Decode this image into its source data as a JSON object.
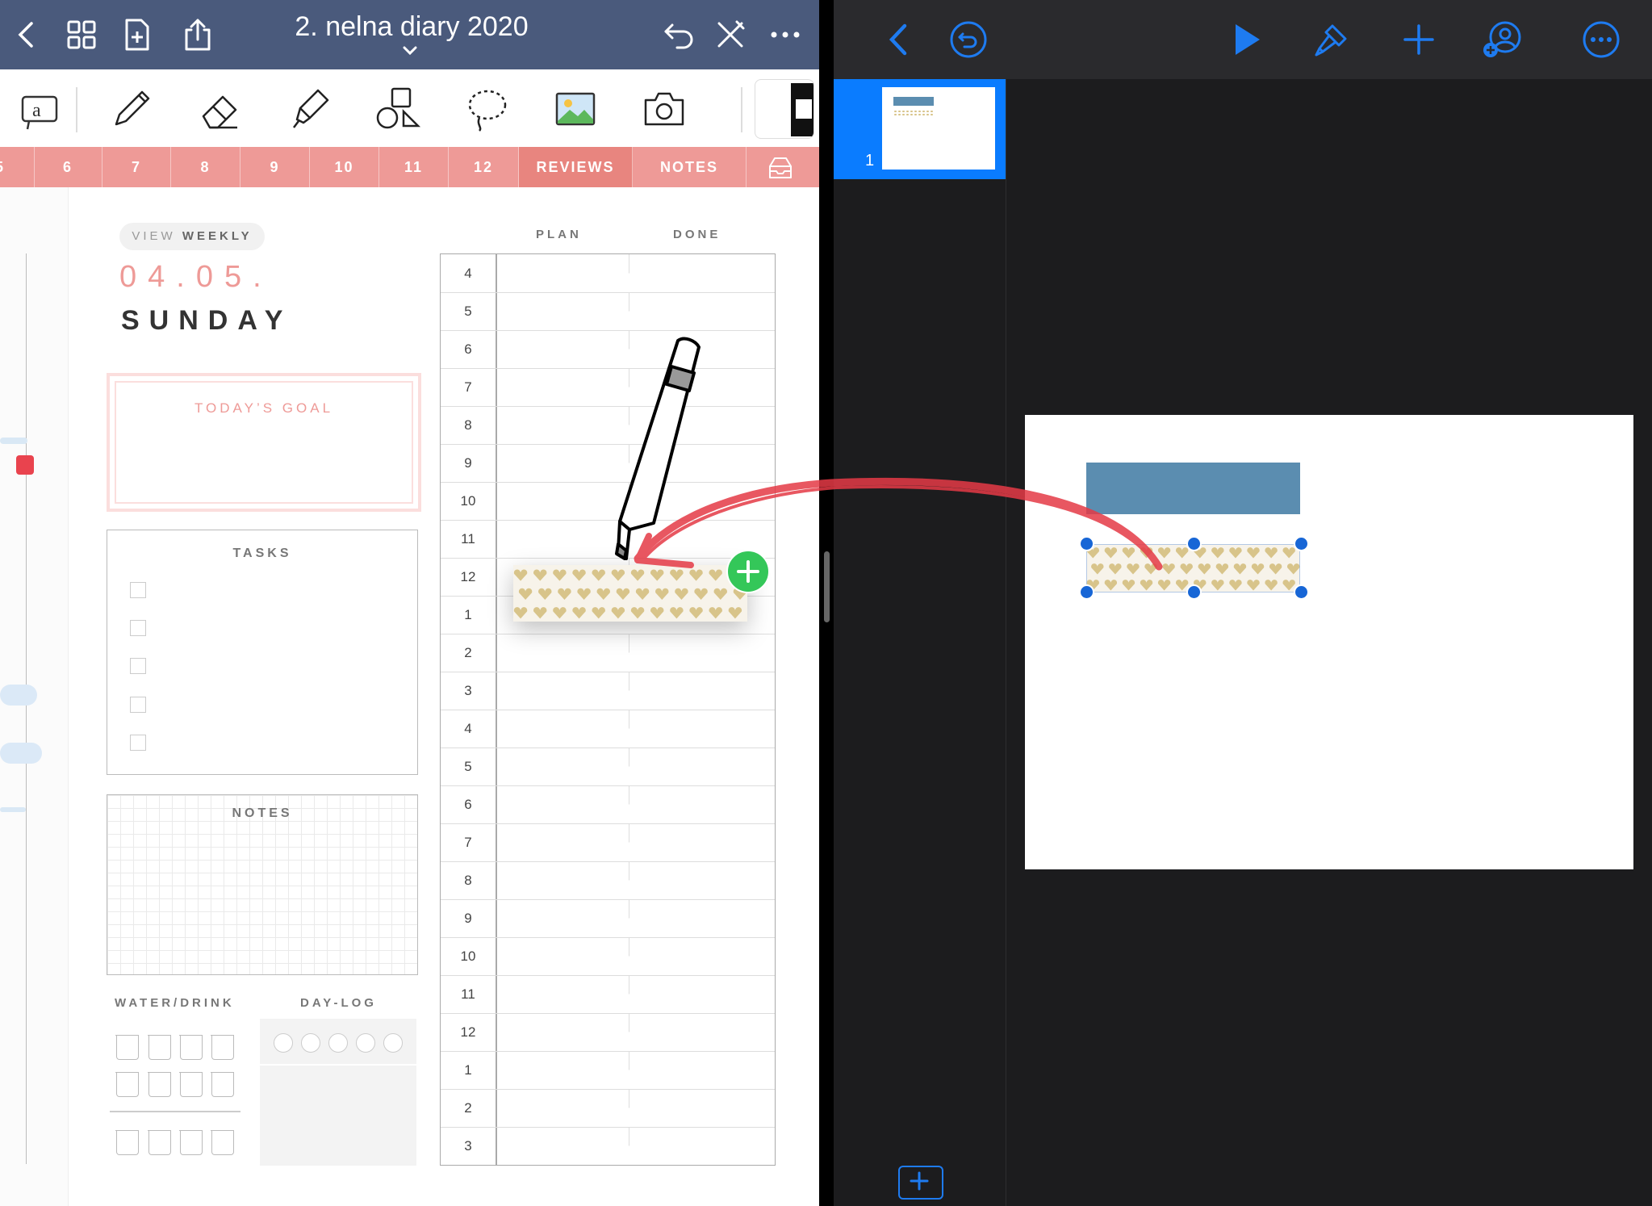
{
  "left_app": {
    "document_title": "2. nelna diary 2020",
    "tabs": [
      {
        "label": "5"
      },
      {
        "label": "6"
      },
      {
        "label": "7"
      },
      {
        "label": "8"
      },
      {
        "label": "9"
      },
      {
        "label": "10"
      },
      {
        "label": "11"
      },
      {
        "label": "12"
      },
      {
        "label": "REVIEWS"
      },
      {
        "label": "NOTES"
      }
    ],
    "planner": {
      "view_prefix": "VIEW",
      "view_mode": "WEEKLY",
      "date": "04.05.",
      "weekday": "SUNDAY",
      "todays_goal_label": "TODAY’S GOAL",
      "tasks_label": "TASKS",
      "notes_label": "NOTES",
      "plan_label": "PLAN",
      "done_label": "DONE",
      "water_label": "WATER/DRINK",
      "daylog_label": "DAY-LOG",
      "hours": [
        "4",
        "5",
        "6",
        "7",
        "8",
        "9",
        "10",
        "11",
        "12",
        "1",
        "2",
        "3",
        "4",
        "5",
        "6",
        "7",
        "8",
        "9",
        "10",
        "11",
        "12",
        "1",
        "2",
        "3"
      ]
    }
  },
  "right_app": {
    "slide_number": "1"
  },
  "colors": {
    "left_topbar": "#4a5a7c",
    "tab_bar": "#ee9a97",
    "accent_blue": "#1e7bf0",
    "add_badge": "#34c759",
    "washi_heart": "#d8c48a",
    "slide_rect": "#5b8db0",
    "arrow": "#e53a46"
  }
}
